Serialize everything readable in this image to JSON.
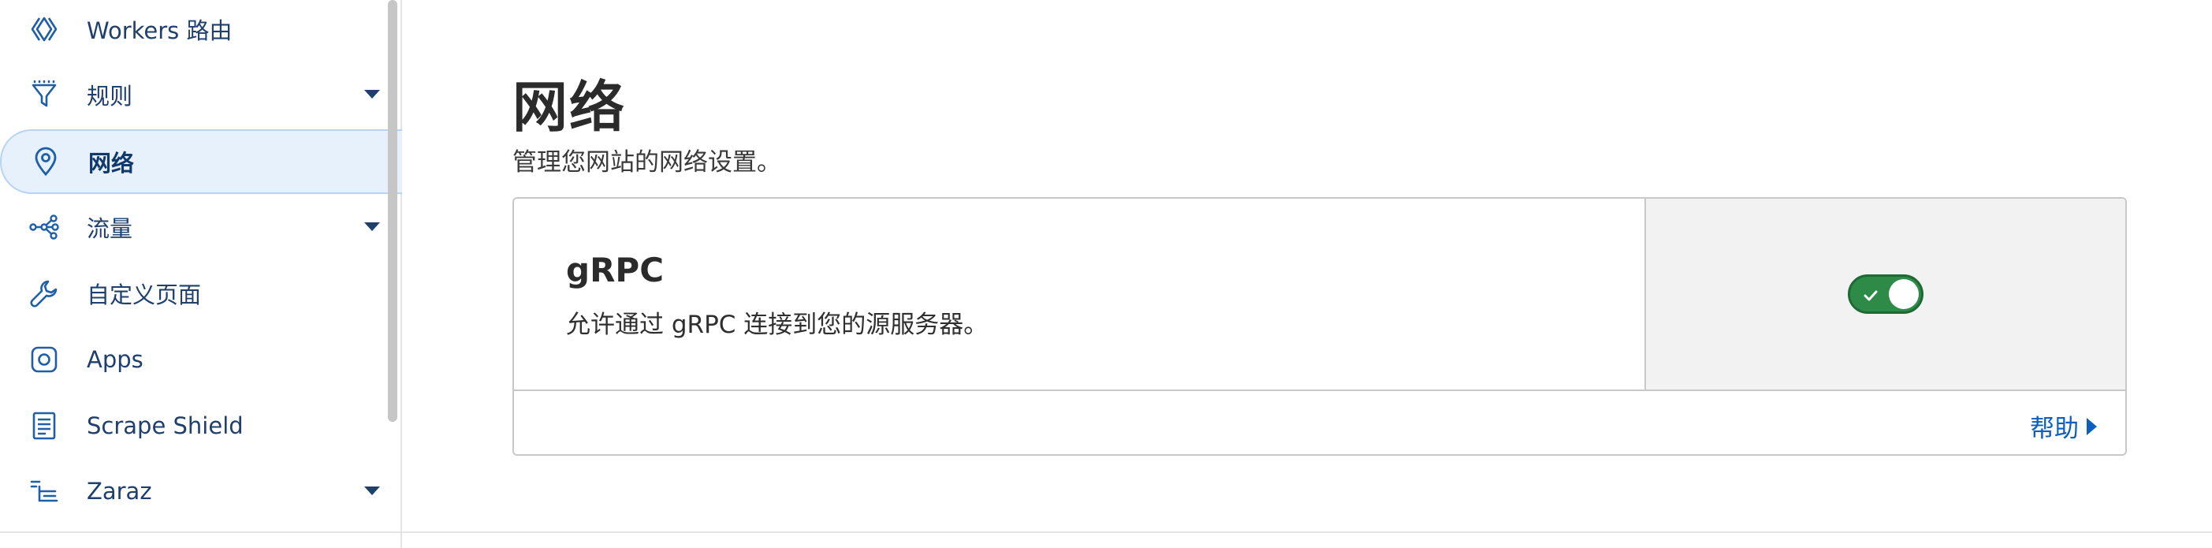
{
  "sidebar": {
    "items": [
      {
        "label": "Workers 路由",
        "icon": "workers-routes-icon",
        "has_caret": false,
        "active": false
      },
      {
        "label": "规则",
        "icon": "rules-funnel-icon",
        "has_caret": true,
        "active": false
      },
      {
        "label": "网络",
        "icon": "location-pin-icon",
        "has_caret": false,
        "active": true
      },
      {
        "label": "流量",
        "icon": "traffic-icon",
        "has_caret": true,
        "active": false
      },
      {
        "label": "自定义页面",
        "icon": "wrench-icon",
        "has_caret": false,
        "active": false
      },
      {
        "label": "Apps",
        "icon": "apps-icon",
        "has_caret": false,
        "active": false
      },
      {
        "label": "Scrape Shield",
        "icon": "document-icon",
        "has_caret": false,
        "active": false
      },
      {
        "label": "Zaraz",
        "icon": "zaraz-icon",
        "has_caret": true,
        "active": false
      }
    ]
  },
  "main": {
    "title": "网络",
    "subtitle": "管理您网站的网络设置。",
    "card": {
      "title": "gRPC",
      "description": "允许通过 gRPC 连接到您的源服务器。",
      "toggle_on": true,
      "help_label": "帮助"
    }
  },
  "colors": {
    "accent": "#0b5fbf",
    "toggle_on": "#2e8b47",
    "active_bg": "#e7f1fc",
    "nav_text": "#1f3f6e"
  }
}
